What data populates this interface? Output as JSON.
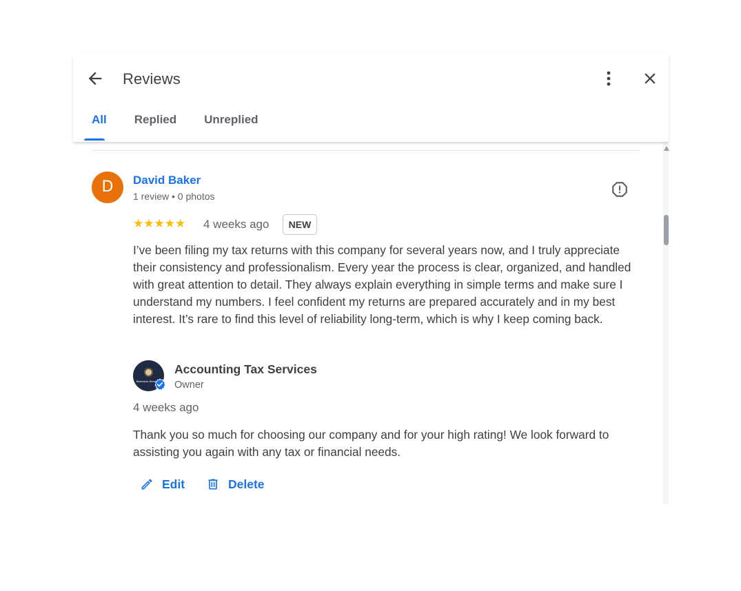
{
  "header": {
    "title": "Reviews",
    "back_icon": "arrow-back-icon",
    "more_icon": "more-vert-icon",
    "close_icon": "close-icon"
  },
  "tabs": [
    {
      "label": "All",
      "active": true
    },
    {
      "label": "Replied",
      "active": false
    },
    {
      "label": "Unreplied",
      "active": false
    }
  ],
  "review": {
    "avatar_letter": "D",
    "avatar_color": "#e8710a",
    "reviewer_name": "David Baker",
    "reviewer_meta": "1 review • 0 photos",
    "rating": 5,
    "stars": "★★★★★",
    "date": "4 weeks ago",
    "badge": "NEW",
    "text": "I’ve been filing my tax returns with this company for several years now, and I truly appreciate their consistency and professionalism. Every year the process is clear, organized, and handled with great attention to detail. They always explain everything in simple terms and make sure I understand my numbers. I feel confident my returns are prepared accurately and in my best interest. It’s rare to find this level of reliability long-term, which is why I keep coming back."
  },
  "reply": {
    "owner_name": "Accounting Tax Services",
    "owner_role": "Owner",
    "logo_text": "Business Services",
    "date": "4 weeks ago",
    "text": "Thank you so much for choosing our company and for your high rating! We look forward to assisting you again with any tax or financial needs.",
    "edit_label": "Edit",
    "delete_label": "Delete"
  },
  "colors": {
    "accent": "#1a73e8",
    "star": "#fbbc04",
    "text": "#3c4043",
    "muted": "#5f6368"
  }
}
